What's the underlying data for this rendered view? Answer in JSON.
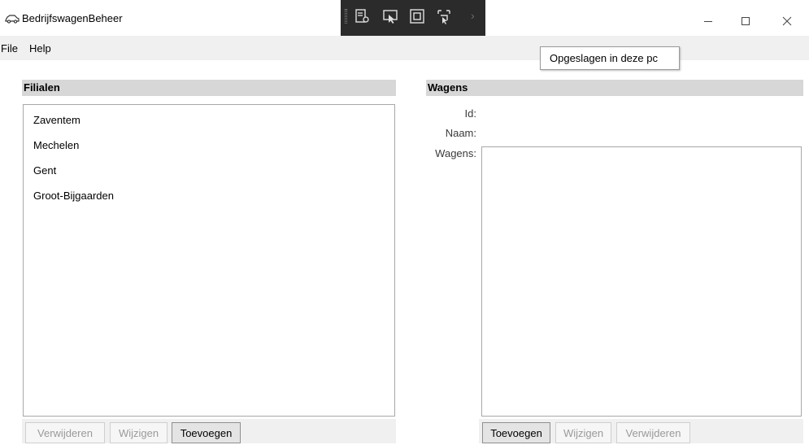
{
  "window": {
    "title": "BedrijfswagenBeheer",
    "minimize_glyph": "–",
    "maximize_glyph": "☐",
    "close_glyph": "✕"
  },
  "menu": {
    "items": [
      "File",
      "Help"
    ]
  },
  "tooltip": {
    "text": "Opgeslagen in deze pc"
  },
  "filialen": {
    "header": "Filialen",
    "items": [
      "Zaventem",
      "Mechelen",
      "Gent",
      "Groot-Bijgaarden"
    ],
    "buttons": {
      "remove": "Verwijderen",
      "edit": "Wijzigen",
      "add": "Toevoegen"
    }
  },
  "wagens": {
    "header": "Wagens",
    "labels": {
      "id": "Id:",
      "name": "Naam:",
      "wagens": "Wagens:"
    },
    "buttons": {
      "add": "Toevoegen",
      "edit": "Wijzigen",
      "remove": "Verwijderen"
    }
  },
  "debug_toolbar": {
    "icons": [
      "live-visual-tree-icon",
      "select-element-icon",
      "display-layout-adorners-icon",
      "track-focus-icon"
    ],
    "overflow_glyph": "›"
  },
  "colors": {
    "header_bg": "#d7d7d7",
    "menubar_bg": "#f0f0f0",
    "debugbar_bg": "#2b2b2b"
  }
}
